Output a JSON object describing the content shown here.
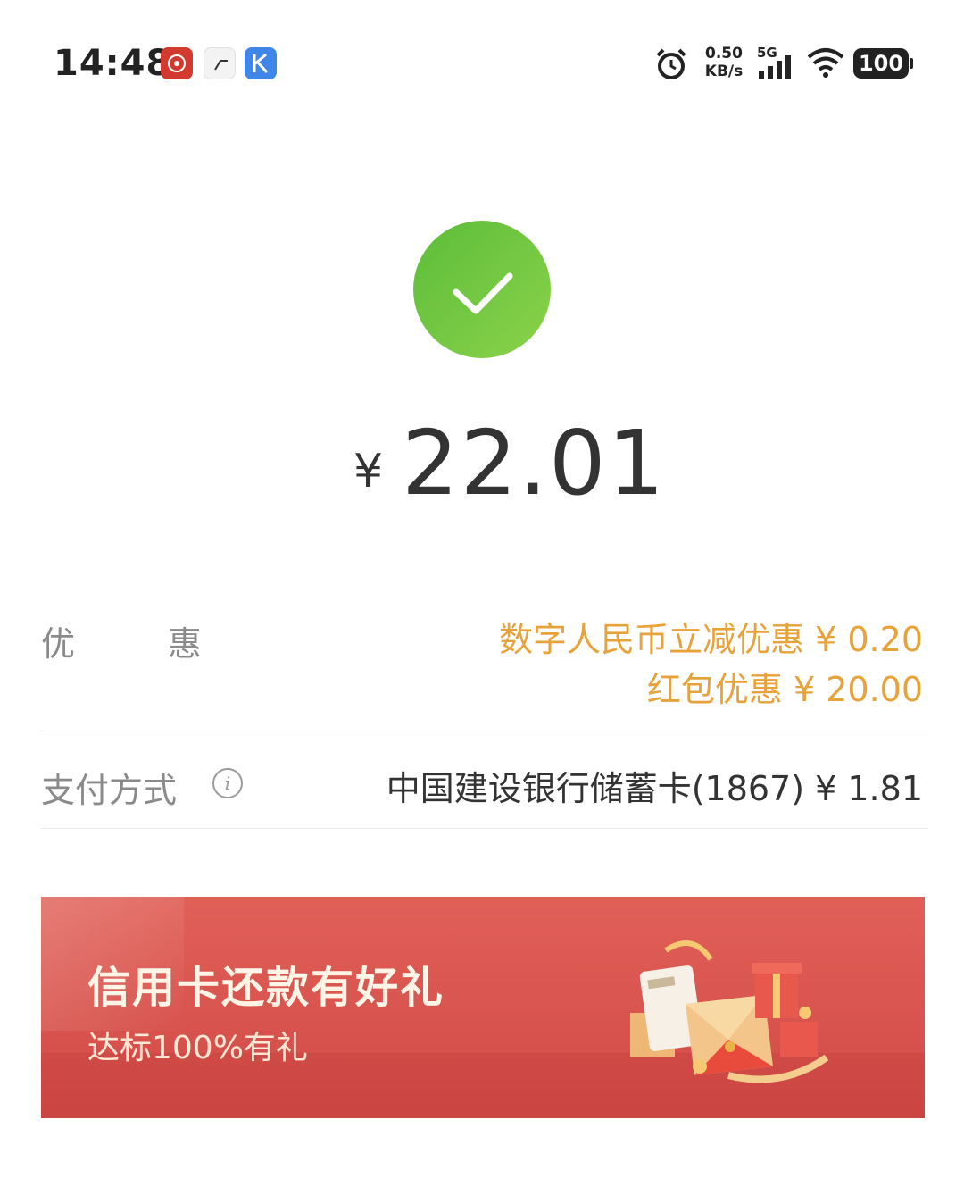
{
  "status_bar": {
    "time": "14:48",
    "net_speed_value": "0.50",
    "net_speed_unit": "KB/s",
    "network_type": "5G",
    "battery": "100",
    "icons": [
      "app-icon-red",
      "app-icon-clock",
      "app-icon-k",
      "alarm-icon",
      "signal-icon",
      "wifi-icon",
      "battery-icon"
    ]
  },
  "payment": {
    "status_icon": "check-icon",
    "currency": "¥",
    "amount": "22.01"
  },
  "discount": {
    "label_first": "优",
    "label_second": "惠",
    "lines": [
      "数字人民币立减优惠 ¥ 0.20",
      "红包优惠 ¥ 20.00"
    ]
  },
  "pay_method": {
    "label": "支付方式",
    "info_icon": "info-icon",
    "value": "中国建设银行储蓄卡(1867) ¥ 1.81"
  },
  "banner": {
    "title": "信用卡还款有好礼",
    "subtitle": "达标100%有礼"
  },
  "colors": {
    "success_green": "#6cc342",
    "discount_orange": "#e8a23a",
    "banner_red": "#d9544f"
  }
}
